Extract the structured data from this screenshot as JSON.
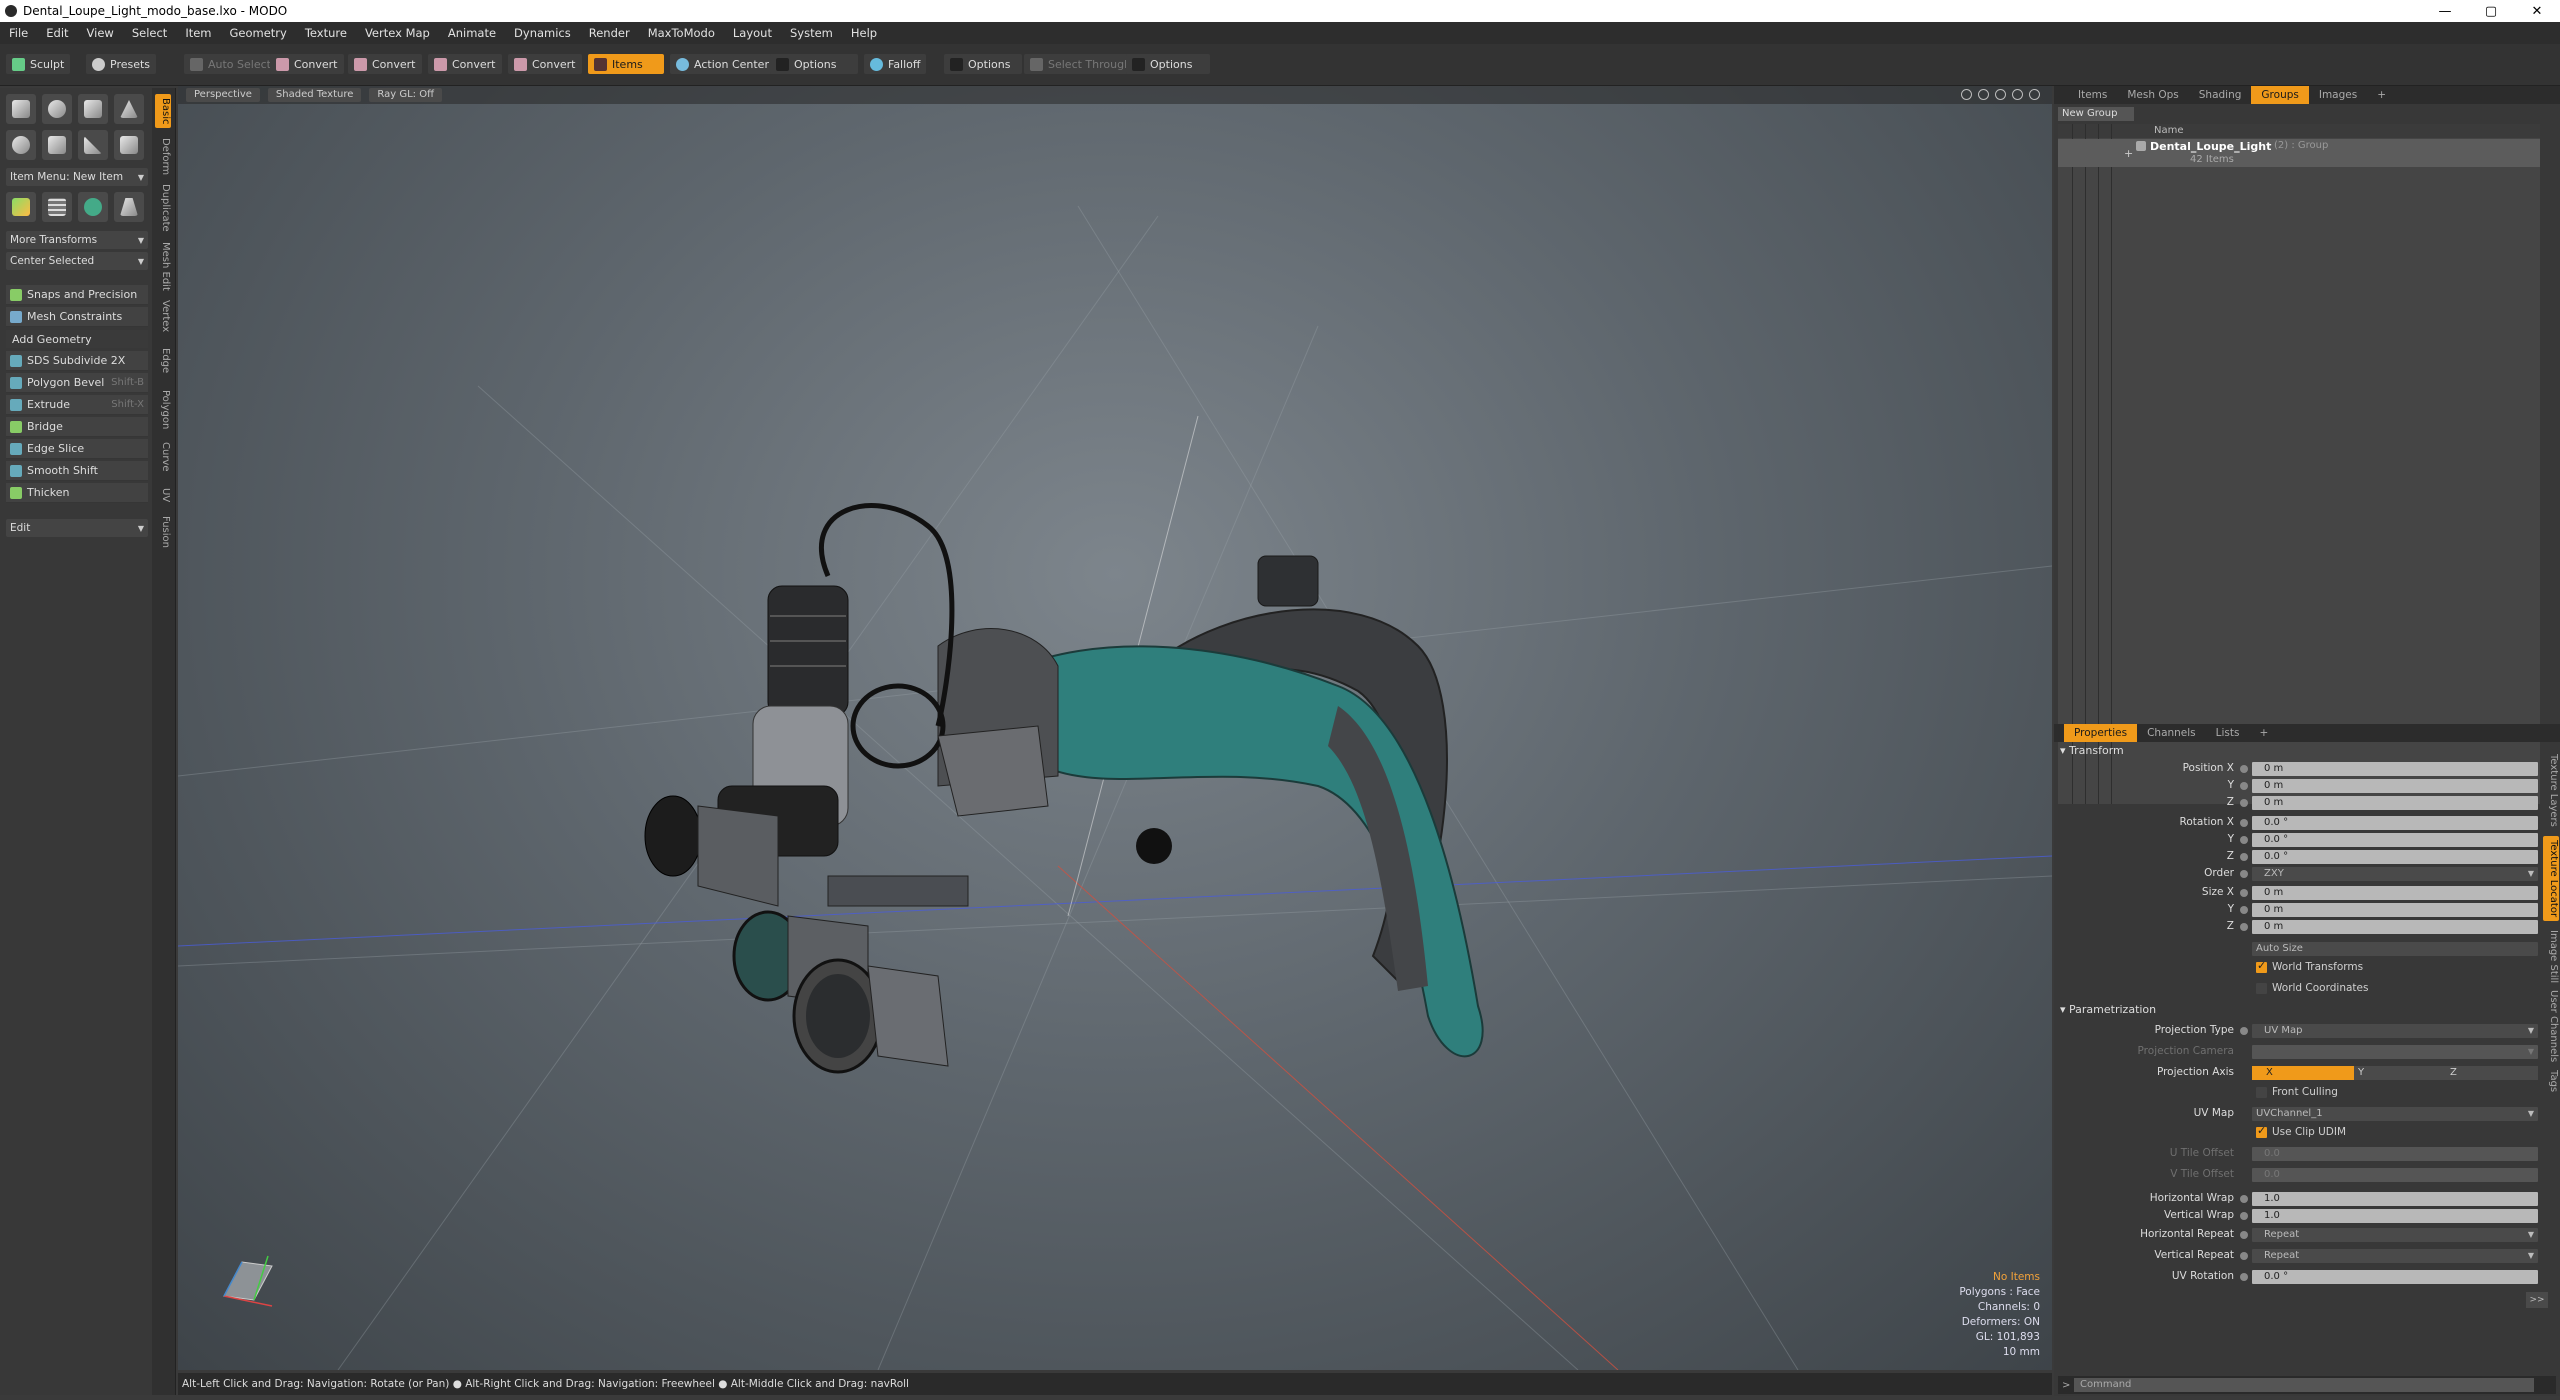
{
  "window": {
    "title": "Dental_Loupe_Light_modo_base.lxo - MODO",
    "controls": [
      "—",
      "▢",
      "✕"
    ]
  },
  "menu": [
    "File",
    "Edit",
    "View",
    "Select",
    "Item",
    "Geometry",
    "Texture",
    "Vertex Map",
    "Animate",
    "Dynamics",
    "Render",
    "MaxToModo",
    "Layout",
    "System",
    "Help"
  ],
  "toolbar": {
    "sculpt": "Sculpt",
    "presets": "Presets",
    "auto_select": "Auto Select",
    "convert1": "Convert",
    "convert2": "Convert",
    "convert3": "Convert",
    "convert4": "Convert",
    "items": "Items",
    "action_center": "Action Center",
    "options1": "Options",
    "falloff": "Falloff",
    "options2": "Options",
    "select_through": "Select Through",
    "options3": "Options"
  },
  "left": {
    "item_menu": "Item Menu: New Item",
    "more_transforms": "More Transforms",
    "center_selected": "Center Selected",
    "snaps": "Snaps and Precision",
    "mesh_constraints": "Mesh Constraints",
    "add_geometry": "Add Geometry",
    "tools": [
      {
        "label": "SDS Subdivide 2X",
        "shortcut": ""
      },
      {
        "label": "Polygon Bevel",
        "shortcut": "Shift-B"
      },
      {
        "label": "Extrude",
        "shortcut": "Shift-X"
      },
      {
        "label": "Bridge",
        "shortcut": ""
      },
      {
        "label": "Edge Slice",
        "shortcut": ""
      },
      {
        "label": "Smooth Shift",
        "shortcut": ""
      },
      {
        "label": "Thicken",
        "shortcut": ""
      }
    ],
    "edit": "Edit",
    "vtabs": [
      "Basic",
      "Deform",
      "Duplicate",
      "Mesh Edit",
      "Vertex",
      "Edge",
      "Polygon",
      "Curve",
      "UV",
      "Fusion"
    ]
  },
  "viewport": {
    "buttons": [
      "Perspective",
      "Shaded Texture",
      "Ray GL: Off"
    ],
    "info": {
      "no_items": "No Items",
      "polygons": "Polygons : Face",
      "channels": "Channels: 0",
      "deformers": "Deformers: ON",
      "gl": "GL: 101,893",
      "scale": "10 mm"
    }
  },
  "status": "Alt-Left Click and Drag: Navigation: Rotate (or Pan) ● Alt-Right Click and Drag: Navigation: Freewheel ● Alt-Middle Click and Drag: navRoll",
  "right": {
    "tabs": [
      "Items",
      "Mesh Ops",
      "Shading",
      "Groups",
      "Images",
      "+"
    ],
    "new_group": "New Group",
    "col_name": "Name",
    "group_name": "Dental_Loupe_Light",
    "group_suffix": "(2) : Group",
    "group_count": "42 Items",
    "prop_tabs": [
      "Properties",
      "Channels",
      "Lists",
      "+"
    ],
    "transform": "Transform",
    "pos_label": "Position X",
    "pos": [
      "0 m",
      "0 m",
      "0 m"
    ],
    "rot_label": "Rotation X",
    "rot": [
      "0.0 °",
      "0.0 °",
      "0.0 °"
    ],
    "y": "Y",
    "z": "Z",
    "order_label": "Order",
    "order": "ZXY",
    "size_label": "Size X",
    "size": [
      "0 m",
      "0 m",
      "0 m"
    ],
    "auto_size": "Auto Size",
    "world_transforms": "World Transforms",
    "world_coords": "World Coordinates",
    "param": "Parametrization",
    "proj_type_label": "Projection Type",
    "proj_type": "UV Map",
    "proj_cam_label": "Projection Camera",
    "proj_axis_label": "Projection Axis",
    "axis": [
      "X",
      "Y",
      "Z"
    ],
    "front_culling": "Front Culling",
    "uvmap_label": "UV Map",
    "uvmap": "UVChannel_1",
    "use_clip": "Use Clip UDIM",
    "utile_label": "U Tile Offset",
    "vtile_label": "V Tile Offset",
    "tile_val": "0.0",
    "hwrap_label": "Horizontal Wrap",
    "hwrap": "1.0",
    "vwrap_label": "Vertical Wrap",
    "vwrap": "1.0",
    "hrep_label": "Horizontal Repeat",
    "hrep": "Repeat",
    "vrep_label": "Vertical Repeat",
    "vrep": "Repeat",
    "uvrot_label": "UV Rotation",
    "uvrot": "0.0 °",
    "more": ">>",
    "side_tabs": [
      "Texture Layers",
      "Texture Locator",
      "Image Still",
      "User Channels",
      "Tags"
    ],
    "command": "Command"
  },
  "colors": {
    "accent": "#f09a1a",
    "teal": "#2f7f7c"
  }
}
